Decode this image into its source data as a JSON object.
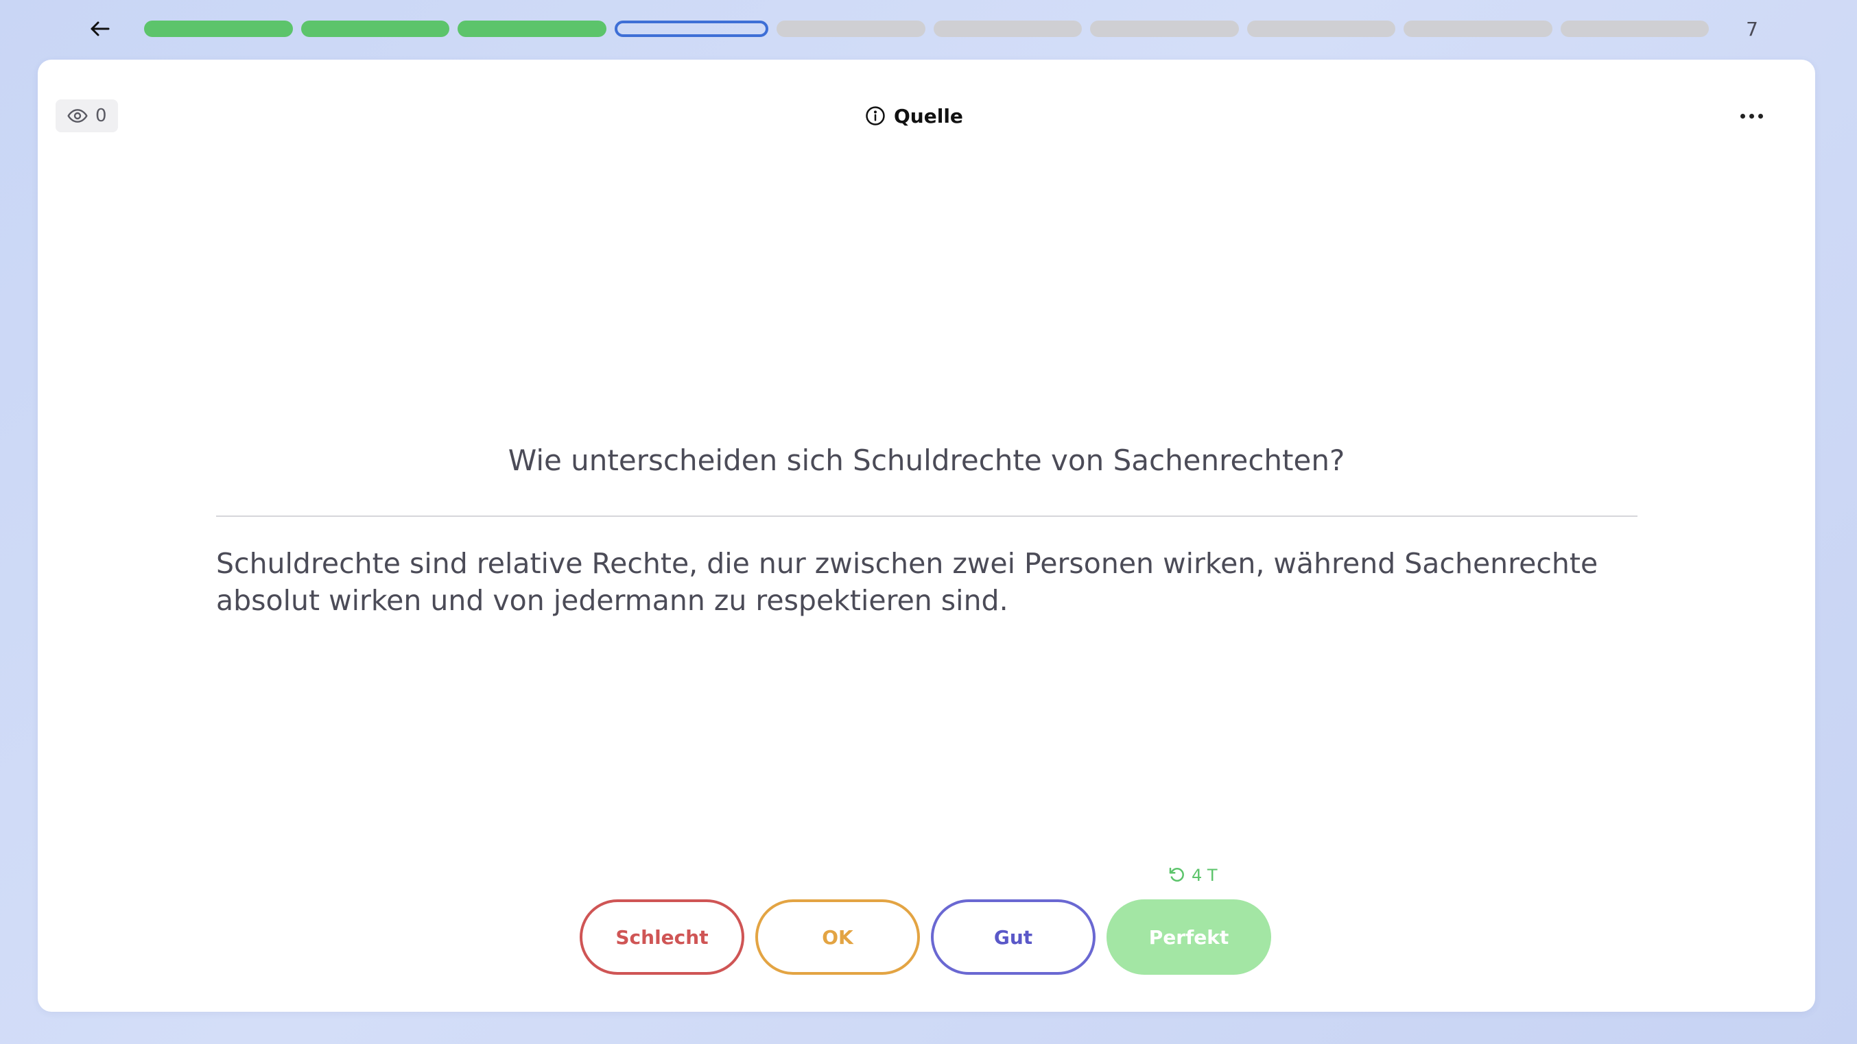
{
  "topbar": {
    "back_icon": "arrow-left-icon",
    "progress_segments": [
      "done",
      "done",
      "done",
      "current",
      "todo",
      "todo",
      "todo",
      "todo",
      "todo",
      "todo"
    ],
    "count": "7"
  },
  "card": {
    "views_count": "0",
    "views_icon": "eye-icon",
    "source_label": "Quelle",
    "source_icon": "info-icon",
    "more_icon": "more-horizontal-icon",
    "question": "Wie unterscheiden sich Schuldrechte von Sachenrechten?",
    "answer": "Schuldrechte sind relative Rechte, die nur zwischen zwei Personen wirken, während Sachenrechte absolut wirken und von jedermann zu respektieren sind."
  },
  "rating": {
    "interval_label": "4 T",
    "interval_icon": "rotate-ccw-icon",
    "buttons": [
      {
        "label": "Schlecht",
        "color": "#cf5555"
      },
      {
        "label": "OK",
        "color": "#e3a443"
      },
      {
        "label": "Gut",
        "color": "#5a58c8"
      },
      {
        "label": "Perfekt",
        "color": "#a3e6a4"
      }
    ]
  }
}
